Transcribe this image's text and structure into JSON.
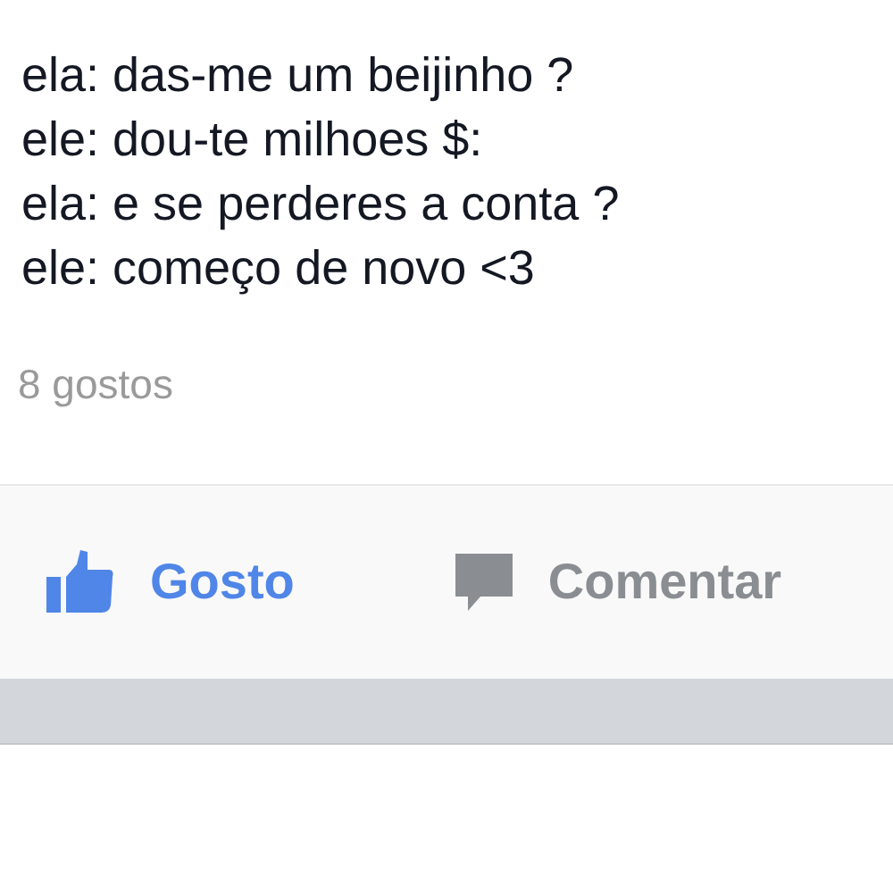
{
  "post": {
    "lines": [
      "ela: das-me um beijinho ?",
      "ele: dou-te milhoes $:",
      "ela: e se perderes a conta ?",
      "ele: começo de novo <3"
    ]
  },
  "likes_count": "8 gostos",
  "actions": [
    {
      "kind": "like",
      "label": "Gosto",
      "selected": true
    },
    {
      "kind": "comment",
      "label": "Comentar",
      "selected": false
    }
  ]
}
